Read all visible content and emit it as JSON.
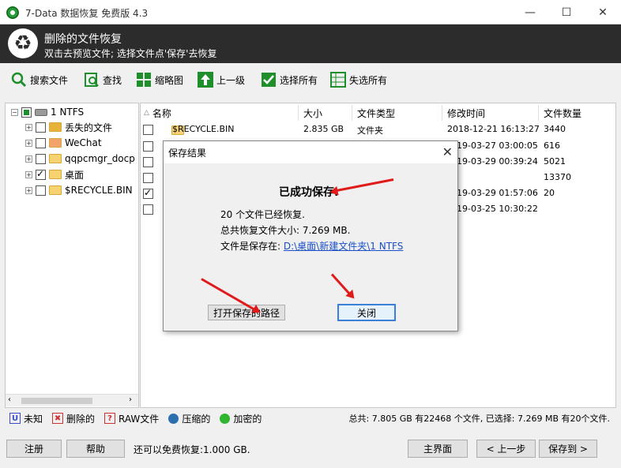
{
  "window": {
    "title": "7-Data 数据恢复 免费版 4.3",
    "minimize": "—",
    "maximize": "☐",
    "close": "✕"
  },
  "header": {
    "title": "删除的文件恢复",
    "subtitle": "双击去预览文件; 选择文件点'保存'去恢复"
  },
  "toolbar": {
    "search_files": "搜索文件",
    "find": "查找",
    "thumbnails": "缩略图",
    "up_level": "上一级",
    "select_all": "选择所有",
    "deselect_all": "失选所有"
  },
  "tree": {
    "root": "1 NTFS",
    "items": [
      {
        "label": "丢失的文件",
        "checked": false
      },
      {
        "label": "WeChat",
        "checked": false
      },
      {
        "label": "qqpcmgr_docp",
        "checked": false
      },
      {
        "label": "桌面",
        "checked": true
      },
      {
        "label": "$RECYCLE.BIN",
        "checked": false
      }
    ]
  },
  "list": {
    "columns": {
      "name": "名称",
      "size": "大小",
      "type": "文件类型",
      "modified": "修改时间",
      "count": "文件数量"
    },
    "rows": [
      {
        "name": "$RECYCLE.BIN",
        "size": "2.835 GB",
        "type": "文件夹",
        "modified": "2018-12-21 16:13:27",
        "count": "3440",
        "checked": false
      },
      {
        "name": "",
        "size": "",
        "type": "",
        "modified": "19-03-27 03:00:05",
        "count": "616",
        "checked": false
      },
      {
        "name": "",
        "size": "",
        "type": "",
        "modified": "19-03-29 00:39:24",
        "count": "5021",
        "checked": false
      },
      {
        "name": "",
        "size": "",
        "type": "",
        "modified": "",
        "count": "13370",
        "checked": false
      },
      {
        "name": "",
        "size": "",
        "type": "",
        "modified": "19-03-29 01:57:06",
        "count": "20",
        "checked": true
      },
      {
        "name": "",
        "size": "",
        "type": "",
        "modified": "19-03-25 10:30:22",
        "count": "",
        "checked": false
      }
    ]
  },
  "legend": {
    "unknown": "未知",
    "deleted": "删除的",
    "raw": "RAW文件",
    "compressed": "压缩的",
    "encrypted": "加密的",
    "summary": "总共: 7.805 GB 有22468 个文件, 已选择: 7.269 MB 有20个文件."
  },
  "bottom": {
    "register": "注册",
    "help": "帮助",
    "free_quota": "还可以免费恢复:1.000 GB.",
    "main": "主界面",
    "prev": "< 上一步",
    "save_to": "保存到 >"
  },
  "dialog": {
    "title": "保存结果",
    "heading": "已成功保存.",
    "line1": "20 个文件已经恢复.",
    "line2": "总共恢复文件大小: 7.269 MB.",
    "line3_prefix": "文件是保存在: ",
    "line3_path": "D:\\桌面\\新建文件夹\\1 NTFS",
    "open_path": "打开保存的路径",
    "close": "关闭"
  },
  "colors": {
    "header_bg": "#2c2c2c",
    "accent_green": "#1e8f2a",
    "arrow_red": "#e01b1b",
    "link": "#1a4fc9"
  }
}
